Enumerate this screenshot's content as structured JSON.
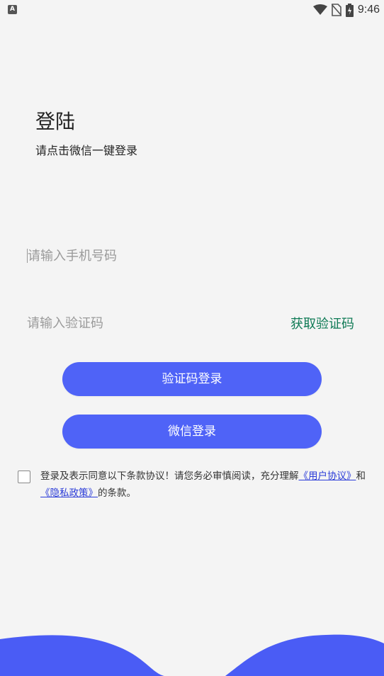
{
  "status": {
    "time": "9:46",
    "left_icon": "A"
  },
  "header": {
    "title": "登陆",
    "subtitle": "请点击微信一键登录"
  },
  "form": {
    "phone_placeholder": "请输入手机号码",
    "code_placeholder": "请输入验证码",
    "get_code_label": "获取验证码"
  },
  "buttons": {
    "code_login": "验证码登录",
    "wechat_login": "微信登录"
  },
  "agreement": {
    "text_before": "登录及表示同意以下条款协议！请您务必审慎阅读，充分理解",
    "user_agreement": "《用户协议》",
    "and": "和",
    "privacy_policy": "《隐私政策》",
    "text_after": "的条款。",
    "checked": false
  },
  "colors": {
    "accent": "#4f63f7",
    "link": "#2a3bd8",
    "get_code": "#0f7a55",
    "wave": "#4a5cf5"
  },
  "icons": [
    "wifi-icon",
    "no-sim-icon",
    "battery-charging-icon"
  ]
}
